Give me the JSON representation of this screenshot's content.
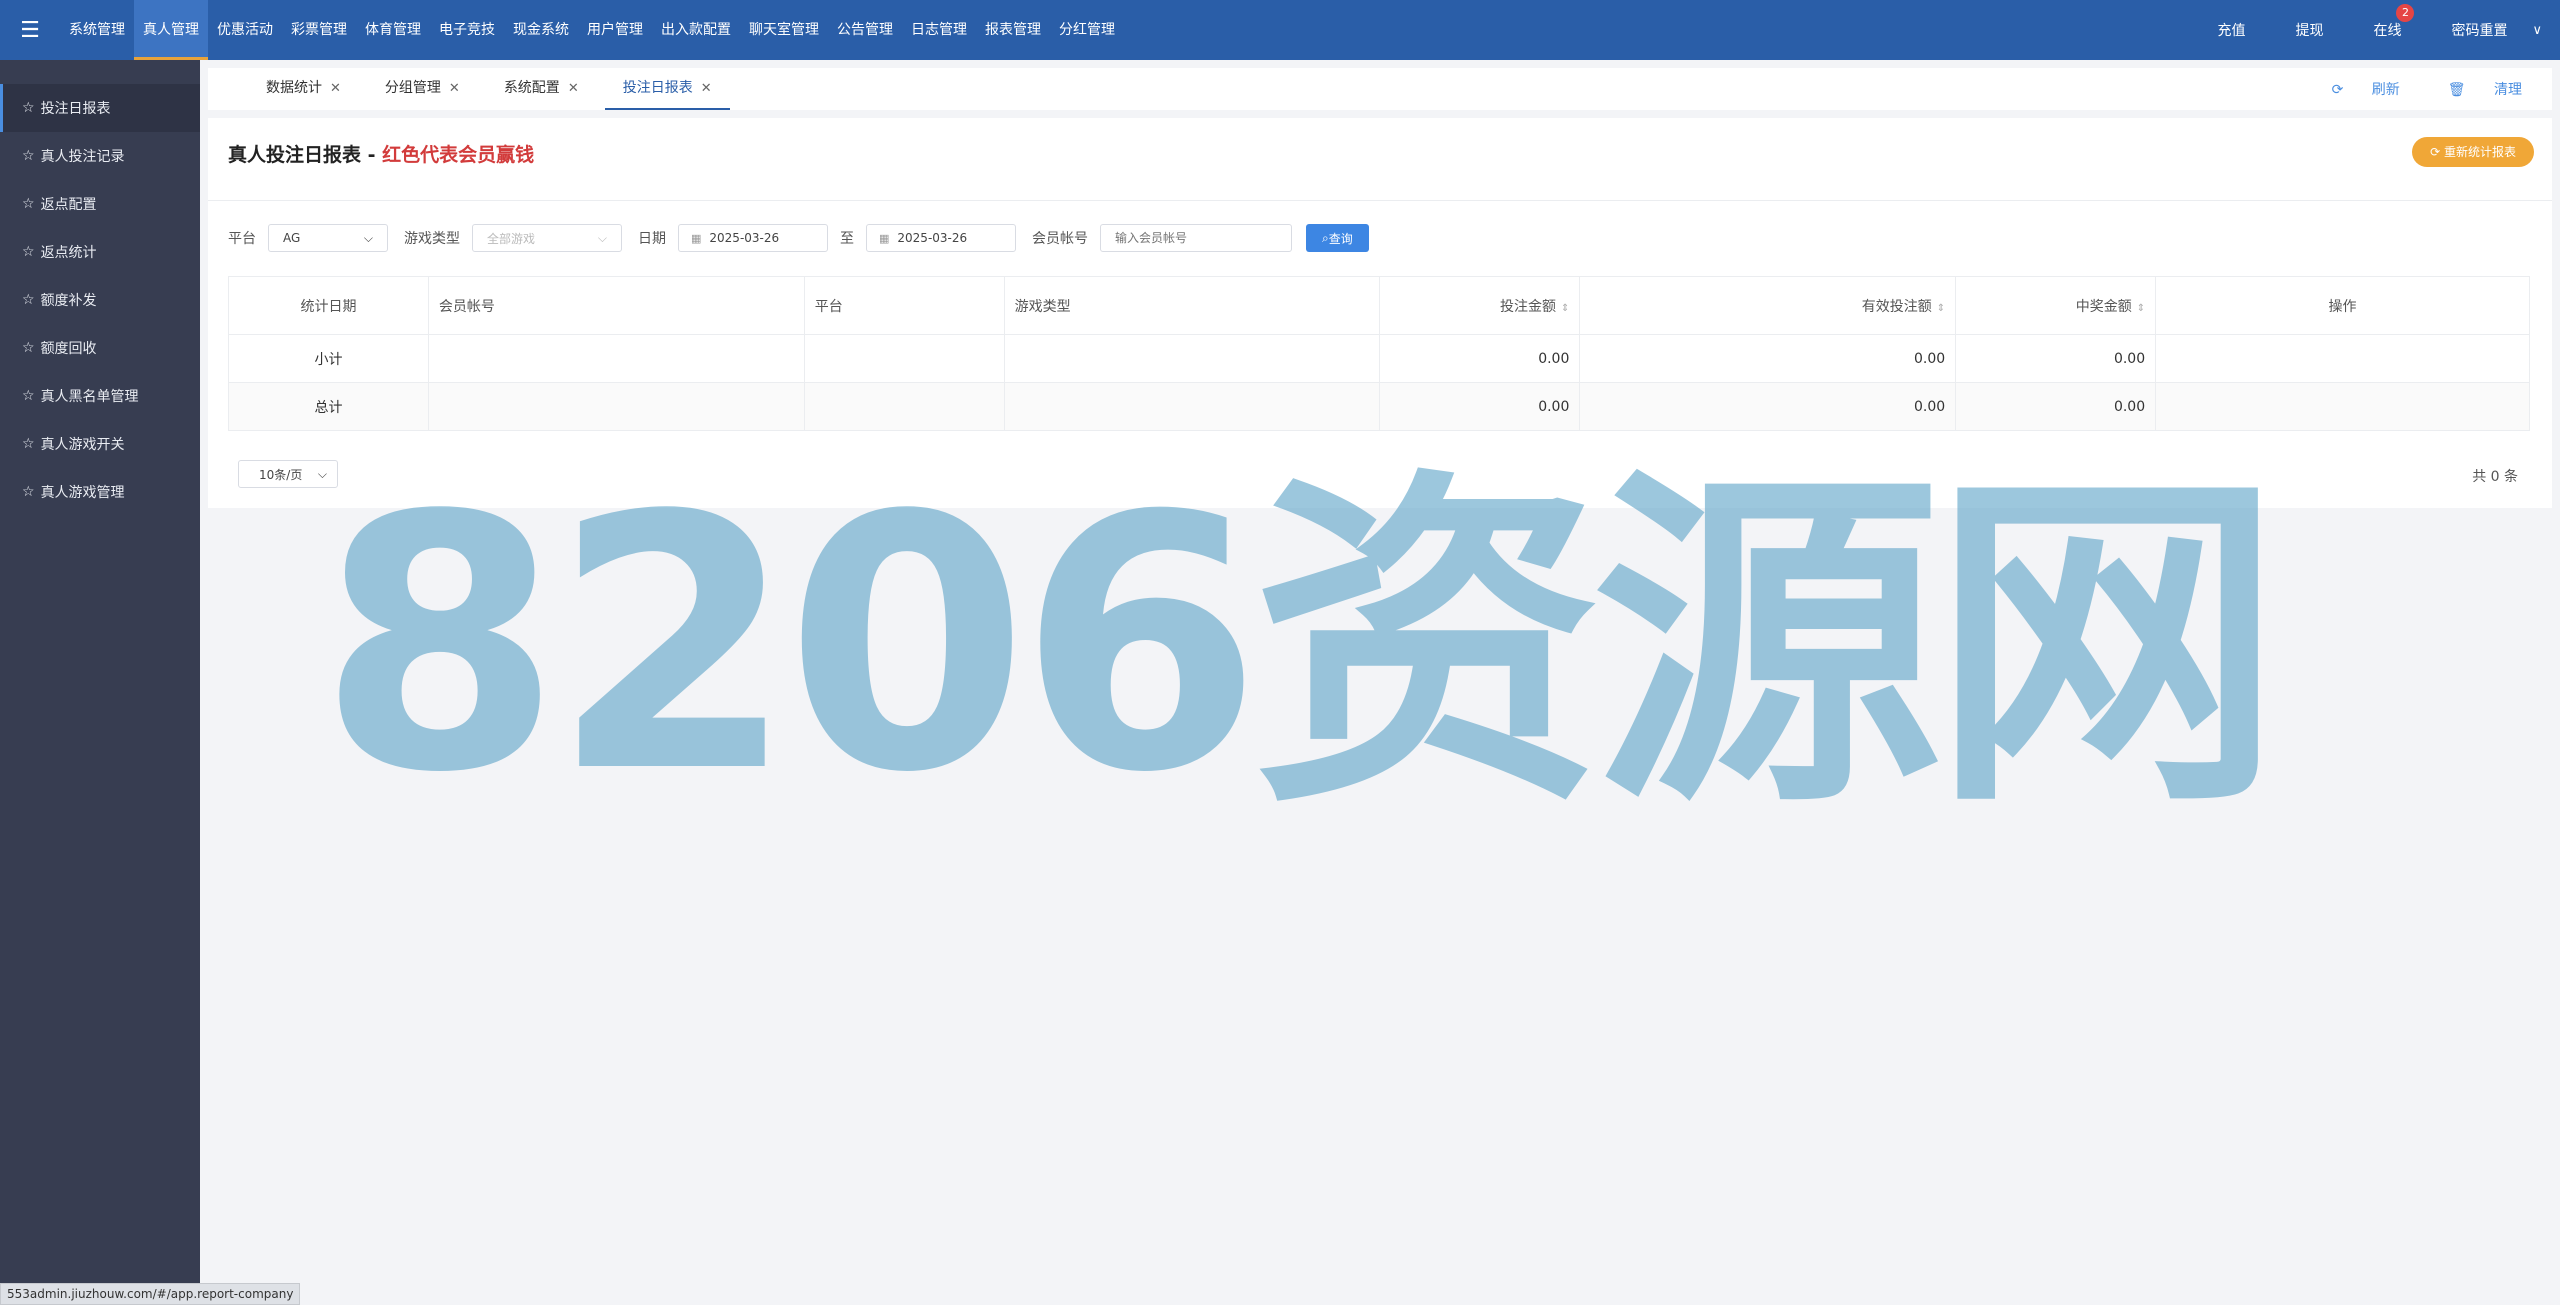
{
  "topnav": {
    "menu_icon": "hamburger-icon",
    "items": [
      "系统管理",
      "真人管理",
      "优惠活动",
      "彩票管理",
      "体育管理",
      "电子竞技",
      "现金系统",
      "用户管理",
      "出入款配置",
      "聊天室管理",
      "公告管理",
      "日志管理",
      "报表管理",
      "分红管理"
    ],
    "active_index": 1,
    "right": {
      "recharge": "充值",
      "withdraw": "提现",
      "online": "在线",
      "online_badge": "2",
      "password_reset": "密码重置"
    },
    "bar_color": "#2a5ea8"
  },
  "sidebar": {
    "items": [
      {
        "label": "投注日报表",
        "icon": "star-icon",
        "active": true
      },
      {
        "label": "真人投注记录",
        "icon": "star-icon"
      },
      {
        "label": "返点配置",
        "icon": "star-icon"
      },
      {
        "label": "返点统计",
        "icon": "star-icon"
      },
      {
        "label": "额度补发",
        "icon": "star-icon"
      },
      {
        "label": "额度回收",
        "icon": "star-icon"
      },
      {
        "label": "真人黑名单管理",
        "icon": "star-icon"
      },
      {
        "label": "真人游戏开关",
        "icon": "star-icon"
      },
      {
        "label": "真人游戏管理",
        "icon": "star-icon"
      }
    ]
  },
  "tabs": {
    "items": [
      "数据统计",
      "分组管理",
      "系统配置",
      "投注日报表"
    ],
    "active_index": 3,
    "refresh": "刷新",
    "clear": "清理"
  },
  "page": {
    "title": "真人投注日报表 - ",
    "title_highlight": "红色代表会员赢钱",
    "recount_button": "重新统计报表"
  },
  "filters": {
    "platform_label": "平台",
    "platform_value": "AG",
    "game_type_label": "游戏类型",
    "game_type_placeholder": "全部游戏",
    "date_label": "日期",
    "date_from": "2025-03-26",
    "date_sep": "至",
    "date_to": "2025-03-26",
    "account_label": "会员帐号",
    "account_placeholder": "输入会员帐号",
    "query_button": "查询"
  },
  "table": {
    "headers": [
      "统计日期",
      "会员帐号",
      "平台",
      "游戏类型",
      "投注金额",
      "有效投注额",
      "中奖金额",
      "操作"
    ],
    "rows": [
      [
        "小计",
        "",
        "",
        "",
        "0.00",
        "0.00",
        "0.00",
        ""
      ],
      [
        "总计",
        "",
        "",
        "",
        "0.00",
        "0.00",
        "0.00",
        ""
      ]
    ]
  },
  "pagination": {
    "page_size": "10条/页",
    "total": "共 0 条"
  },
  "watermark": "8206资源网",
  "status_url": "553admin.jiuzhouw.com/#/app.report-company"
}
